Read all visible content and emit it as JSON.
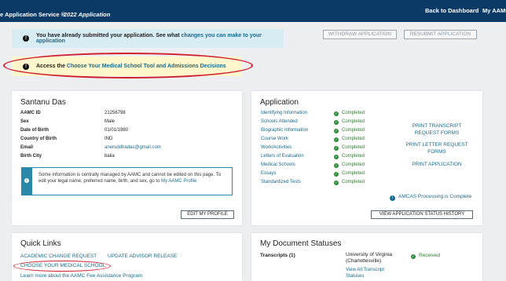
{
  "header": {
    "brand": "e Application Service ®",
    "year": "2022 Application",
    "nav": [
      "Back to Dashboard",
      "My AAMC"
    ]
  },
  "alerts": {
    "submitted": {
      "text": "You have already submitted your application. See what",
      "link": "changes you can make to your application",
      "icon": "exclamation-icon"
    },
    "access": {
      "text": "Access the",
      "link": "Choose Your Medical School Tool and Admissions Decisions",
      "icon": "exclamation-icon"
    }
  },
  "actions": {
    "withdraw": "WITHDRAW APPLICATION",
    "resubmit": "RESUBMIT APPLICATION"
  },
  "profile": {
    "name": "Santanu Das",
    "fields": [
      {
        "label": "AAMC ID",
        "value": "21256798"
      },
      {
        "label": "Sex",
        "value": "Male"
      },
      {
        "label": "Date of Birth",
        "value": "01/01/1980"
      },
      {
        "label": "Country of Birth",
        "value": "IND"
      },
      {
        "label": "Email",
        "value": "aneruddhadas@gmail.com"
      },
      {
        "label": "Birth City",
        "value": "balia"
      }
    ],
    "info_text": "Some information is centrally managed by AAMC and cannot be edited on this page. To edit your legal name, preferred name, birth, and sex, go to",
    "info_link": "My AAMC Profile",
    "edit_button": "EDIT MY PROFILE"
  },
  "application": {
    "title": "Application",
    "processing": "AMCAS Processing is Complete",
    "items": [
      {
        "label": "Identifying Information",
        "status": "Completed"
      },
      {
        "label": "Schools Attended",
        "status": "Completed"
      },
      {
        "label": "Biographic Information",
        "status": "Completed"
      },
      {
        "label": "Course Work",
        "status": "Completed"
      },
      {
        "label": "Work/Activities",
        "status": "Completed"
      },
      {
        "label": "Letters of Evaluation",
        "status": "Completed"
      },
      {
        "label": "Medical Schools",
        "status": "Completed"
      },
      {
        "label": "Essays",
        "status": "Completed"
      },
      {
        "label": "Standardized Tests",
        "status": "Completed"
      }
    ],
    "print_links": [
      "PRINT TRANSCRIPT REQUEST FORMS",
      "PRINT LETTER REQUEST FORMS",
      "PRINT APPLICATION"
    ],
    "history_button": "VIEW APPLICATION STATUS HISTORY"
  },
  "quick_links": {
    "title": "Quick Links",
    "links": [
      "ACADEMIC CHANGE REQUEST",
      "UPDATE ADVISOR RELEASE",
      "CHOOSE YOUR MEDICAL SCHOOL",
      "Learn more about the AAMC Fee Assistance Program"
    ]
  },
  "documents": {
    "title": "My Document Statuses",
    "transcripts_label": "Transcripts (1)",
    "school": "University of Virginia (Charlottesville)",
    "view_all": "View All Transcript Statuses",
    "status": "Received"
  },
  "colors": {
    "header_bg": "#0b3a66",
    "link": "#1a6a8a",
    "completed": "#2e7d32",
    "highlight": "#d02030"
  }
}
